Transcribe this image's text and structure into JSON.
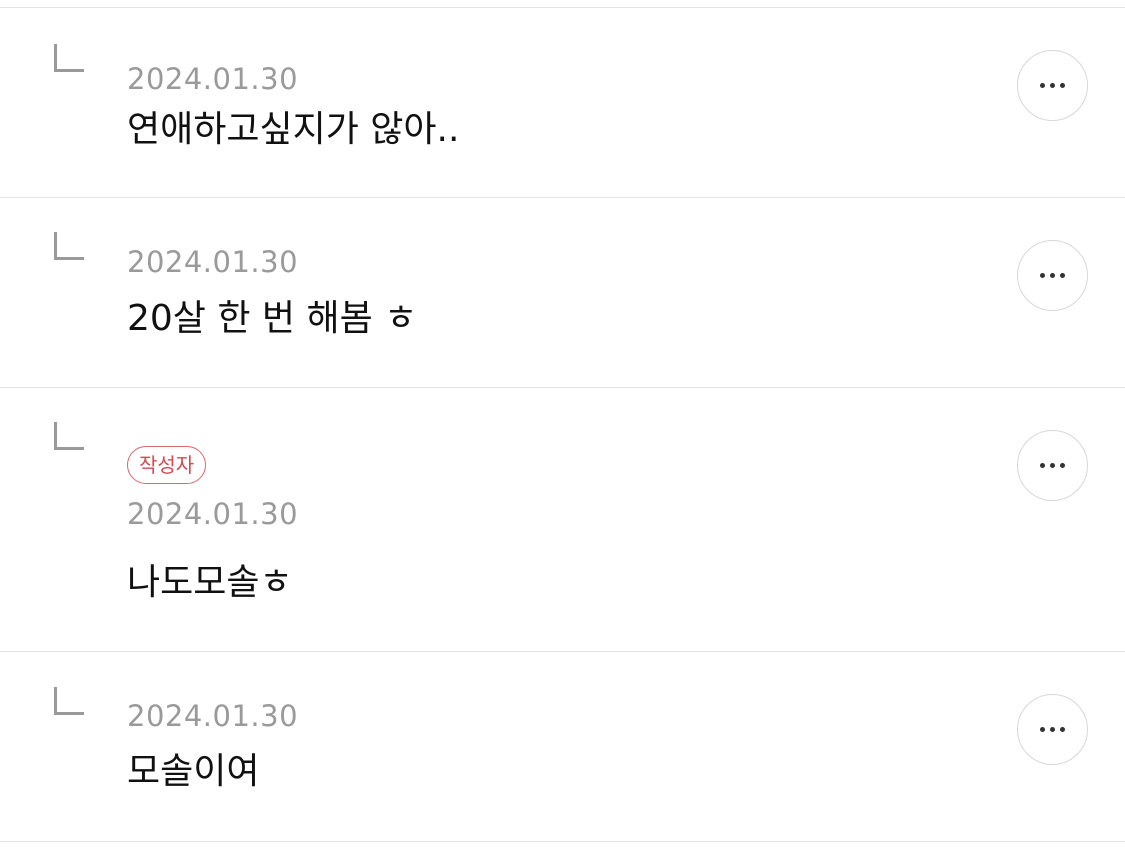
{
  "replies": [
    {
      "date": "2024.01.30",
      "text": "연애하고싶지가 않아..",
      "more_icon": "more-horizontal-icon"
    },
    {
      "date": "2024.01.30",
      "text": "20살 한 번 해봄 ㅎ",
      "more_icon": "more-horizontal-icon"
    },
    {
      "badge": "작성자",
      "date": "2024.01.30",
      "text": "나도모솔ㅎ",
      "more_icon": "more-horizontal-icon"
    },
    {
      "date": "2024.01.30",
      "text": "모솔이여",
      "more_icon": "more-horizontal-icon"
    }
  ],
  "colors": {
    "badge": "#d24b53",
    "date": "#9a9a9a",
    "divider": "#e3e3e3"
  }
}
